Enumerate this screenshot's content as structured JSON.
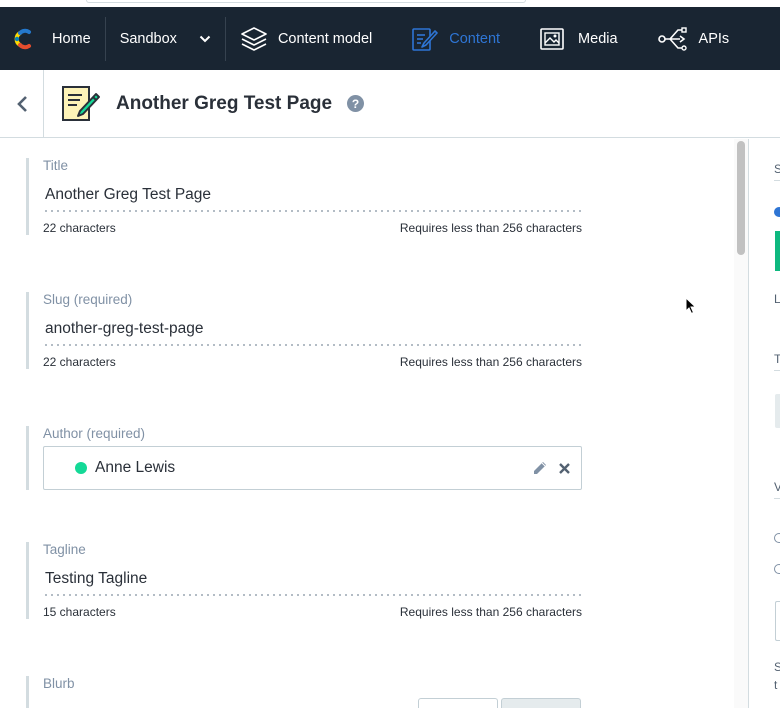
{
  "nav": {
    "home": "Home",
    "space": "Sandbox",
    "content_model": "Content model",
    "content": "Content",
    "media": "Media",
    "apis": "APIs",
    "active_color": "#2e75d4",
    "bg_color": "#192532"
  },
  "header": {
    "title": "Another Greg Test Page",
    "help": "?"
  },
  "fields": {
    "title": {
      "label": "Title",
      "value": "Another Greg Test Page",
      "count": "22 characters",
      "limit": "Requires less than 256 characters"
    },
    "slug": {
      "label": "Slug (required)",
      "value": "another-greg-test-page",
      "count": "22 characters",
      "limit": "Requires less than 256 characters"
    },
    "author": {
      "label": "Author (required)",
      "value": "Anne Lewis",
      "status_color": "#14d997"
    },
    "tagline": {
      "label": "Tagline",
      "value": "Testing Tagline",
      "count": "15 characters",
      "limit": "Requires less than 256 characters"
    },
    "blurb": {
      "label": "Blurb"
    }
  },
  "sidebar": {
    "s": "S",
    "l": "L",
    "t": "T",
    "v": "V",
    "s2": "S",
    "t2": "t"
  },
  "icons": {
    "logo": "contentful-logo-icon",
    "stack": "layers-icon",
    "content": "edit-document-icon",
    "media": "image-icon",
    "apis": "share-nodes-icon",
    "back": "chevron-left-icon",
    "edit": "pencil-icon",
    "remove": "close-icon"
  }
}
